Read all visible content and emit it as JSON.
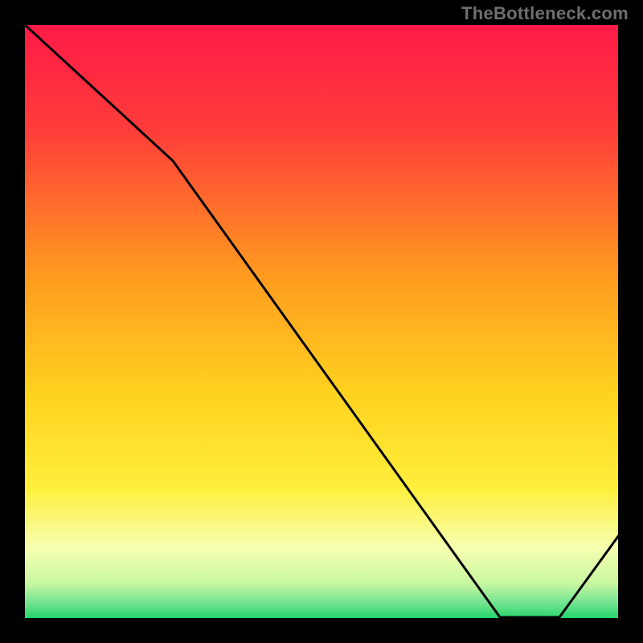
{
  "watermark": "TheBottleneck.com",
  "plot_label": "",
  "chart_data": {
    "type": "line",
    "title": "",
    "xlabel": "",
    "ylabel": "",
    "xlim": [
      0,
      100
    ],
    "ylim": [
      0,
      100
    ],
    "grid": false,
    "legend": false,
    "background_gradient": {
      "top": "#ff1a47",
      "mid1": "#ff9a1f",
      "mid2": "#ffe63b",
      "low": "#f6ffb0",
      "bottom": "#22d36b"
    },
    "x": [
      0,
      25,
      80,
      90,
      100
    ],
    "y": [
      100,
      77,
      0,
      0,
      14
    ],
    "notes": "Single black line over rainbow vertical gradient; flat minimum from x≈80 to x≈90 then rises."
  }
}
